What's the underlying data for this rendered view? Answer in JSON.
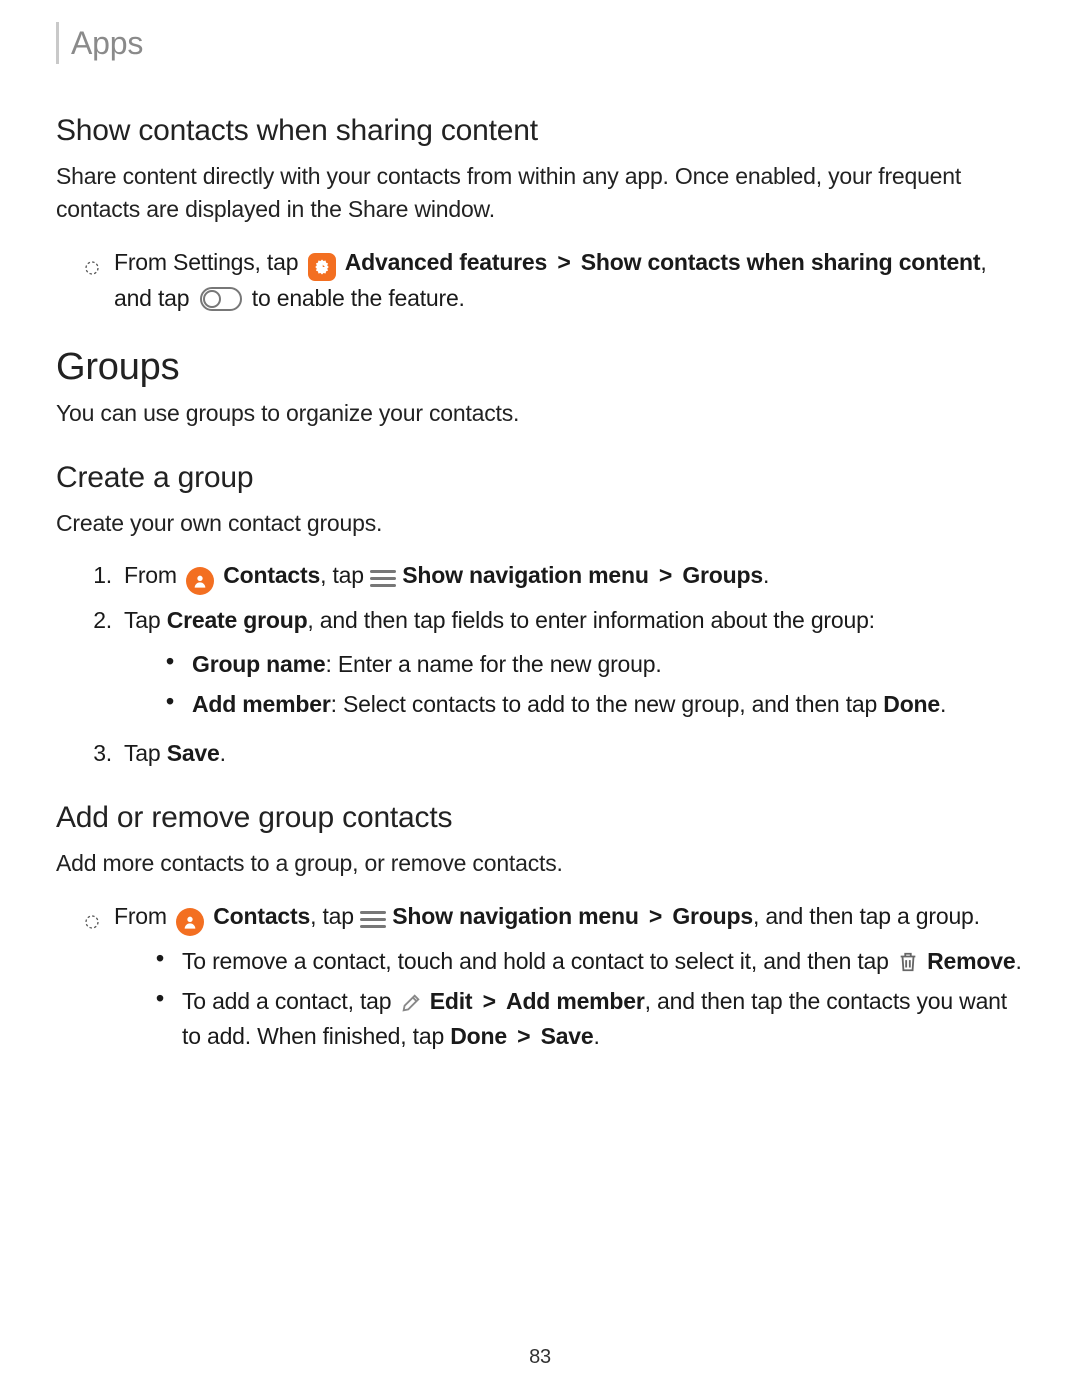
{
  "breadcrumb": "Apps",
  "page_number": "83",
  "t": {
    "from_settings_tap": "From Settings, tap",
    "advanced_features": "Advanced features",
    "gt": ">",
    "show_contacts_when_sharing": "Show contacts when sharing content",
    "comma_and_tap": ", and tap",
    "to_enable_feature": "to enable the feature.",
    "from": "From",
    "contacts": "Contacts",
    "tap": ", tap",
    "show_nav_menu": "Show navigation menu",
    "groups_label": "Groups",
    "period": ".",
    "tap_word": "Tap ",
    "create_group_bold": "Create group",
    "create_group_tail": ", and then tap fields to enter information about the group:",
    "group_name_bold": "Group name",
    "group_name_tail": ": Enter a name for the new group.",
    "add_member_bold": "Add member",
    "add_member_tail": ": Select contacts to add to the new group, and then tap ",
    "done_bold": "Done",
    "save_bold": "Save",
    "groups_and_tap_group": ", and then tap a group.",
    "remove_lead": "To remove a contact, touch and hold a contact to select it, and then tap",
    "remove_bold": "Remove",
    "add_lead": "To add a contact, tap",
    "edit_bold": "Edit",
    "add_tail1": ", and then tap the contacts you want to add. When finished, tap "
  },
  "sections": {
    "share": {
      "heading": "Show contacts when sharing content",
      "intro": "Share content directly with your contacts from within any app. Once enabled, your frequent contacts are displayed in the Share window."
    },
    "groups": {
      "heading": "Groups",
      "intro": "You can use groups to organize your contacts."
    },
    "create": {
      "heading": "Create a group",
      "intro": "Create your own contact groups."
    },
    "addremove": {
      "heading": "Add or remove group contacts",
      "intro": "Add more contacts to a group, or remove contacts."
    }
  }
}
